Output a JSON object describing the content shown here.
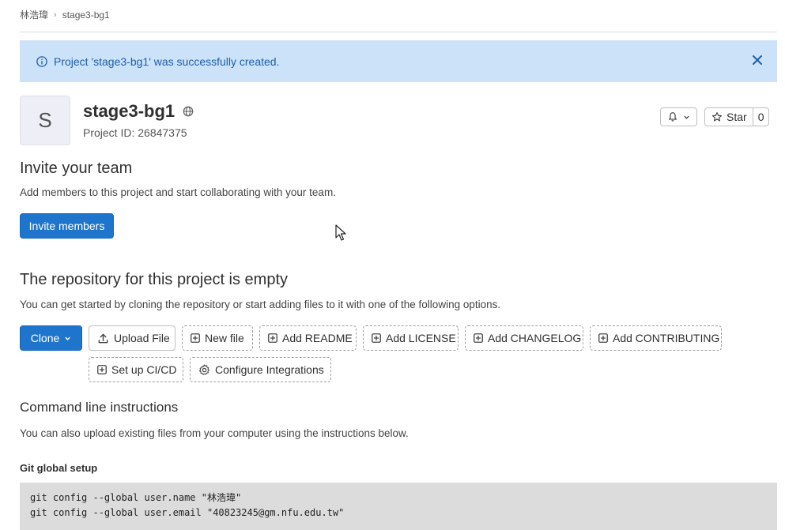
{
  "breadcrumb": {
    "items": [
      "林浩瑋",
      "stage3-bg1"
    ]
  },
  "alert": {
    "message": "Project 'stage3-bg1' was successfully created.",
    "icon": "info-icon",
    "close_icon": "close-icon",
    "color": "#1f5ea8",
    "background": "#cbe2f9"
  },
  "project": {
    "avatar_letter": "S",
    "name": "stage3-bg1",
    "visibility_icon": "globe-icon",
    "id_text": "Project ID: 26847375"
  },
  "header_actions": {
    "notification_icon": "bell-icon",
    "star_label": "Star",
    "star_count": "0"
  },
  "invite": {
    "heading": "Invite your team",
    "description": "Add members to this project and start collaborating with your team.",
    "button_label": "Invite members"
  },
  "empty_repo": {
    "heading": "The repository for this project is empty",
    "description": "You can get started by cloning the repository or start adding files to it with one of the following options.",
    "clone_label": "Clone",
    "options": [
      {
        "label": "Upload File",
        "icon": "upload-icon"
      },
      {
        "label": "New file",
        "icon": "plus-square-icon"
      },
      {
        "label": "Add README",
        "icon": "plus-square-icon"
      },
      {
        "label": "Add LICENSE",
        "icon": "plus-square-icon"
      },
      {
        "label": "Add CHANGELOG",
        "icon": "plus-square-icon"
      },
      {
        "label": "Add CONTRIBUTING",
        "icon": "plus-square-icon"
      },
      {
        "label": "Set up CI/CD",
        "icon": "plus-square-icon"
      },
      {
        "label": "Configure Integrations",
        "icon": "gear-icon"
      }
    ]
  },
  "cli": {
    "heading": "Command line instructions",
    "description": "You can also upload existing files from your computer using the instructions below.",
    "git_setup_heading": "Git global setup",
    "code_lines": [
      "git config --global user.name \"林浩瑋\"",
      "git config --global user.email \"40823245@gm.nfu.edu.tw\""
    ]
  },
  "colors": {
    "primary": "#1f75cb",
    "text": "#303030"
  }
}
